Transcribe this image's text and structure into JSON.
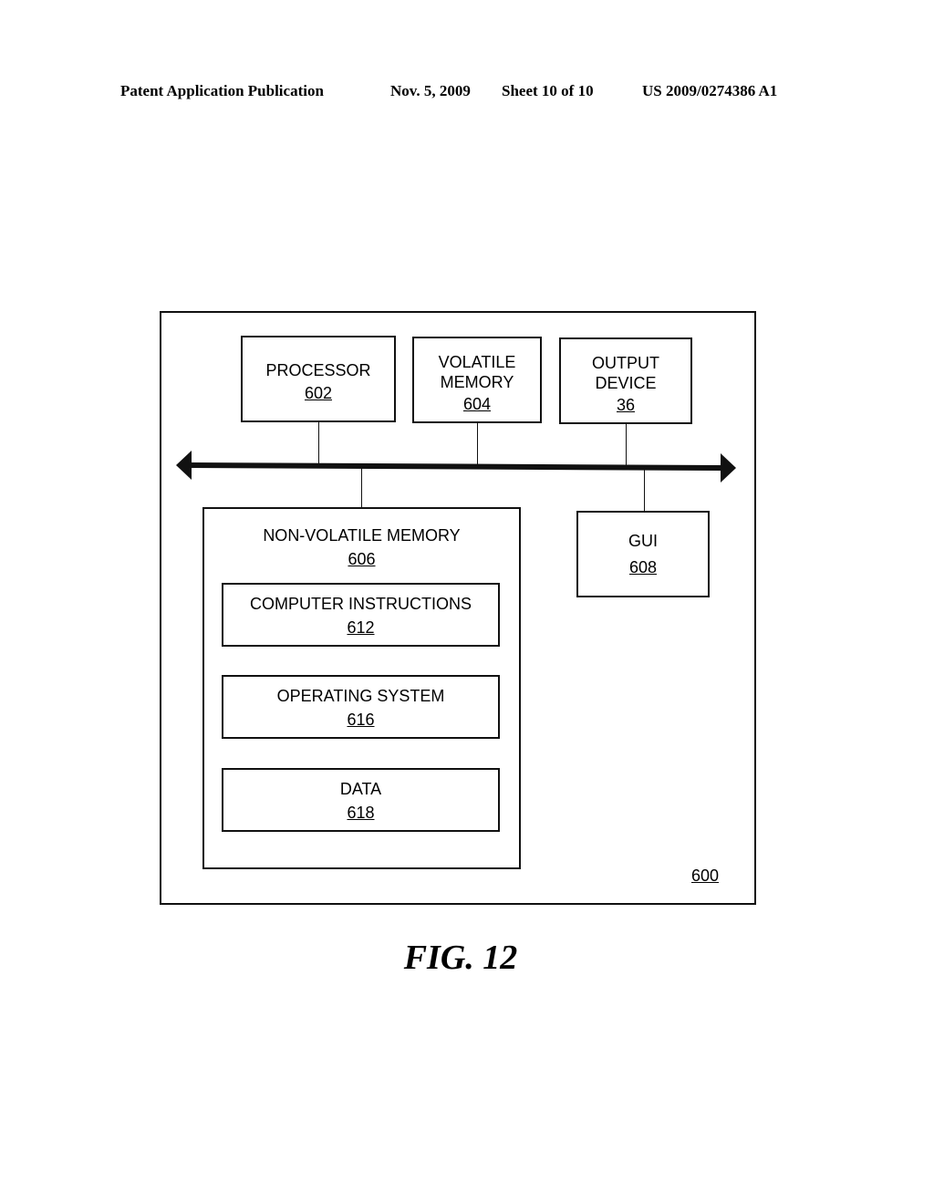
{
  "header": {
    "publication": "Patent Application Publication",
    "date": "Nov. 5, 2009",
    "sheet": "Sheet 10 of 10",
    "number": "US 2009/0274386 A1"
  },
  "diagram": {
    "system_ref": "600",
    "blocks": {
      "processor": {
        "title": "PROCESSOR",
        "ref": "602"
      },
      "volatile_memory": {
        "title1": "VOLATILE",
        "title2": "MEMORY",
        "ref": "604"
      },
      "output_device": {
        "title1": "OUTPUT",
        "title2": "DEVICE",
        "ref": "36"
      },
      "non_volatile_memory": {
        "title": "NON-VOLATILE MEMORY",
        "ref": "606"
      },
      "computer_instructions": {
        "title": "COMPUTER INSTRUCTIONS",
        "ref": "612"
      },
      "operating_system": {
        "title": "OPERATING SYSTEM",
        "ref": "616"
      },
      "data": {
        "title": "DATA",
        "ref": "618"
      },
      "gui": {
        "title": "GUI",
        "ref": "608"
      }
    },
    "connections": [
      [
        "processor",
        "bus"
      ],
      [
        "volatile_memory",
        "bus"
      ],
      [
        "output_device",
        "bus"
      ],
      [
        "non_volatile_memory",
        "bus"
      ],
      [
        "gui",
        "bus"
      ]
    ]
  },
  "caption": "FIG. 12"
}
